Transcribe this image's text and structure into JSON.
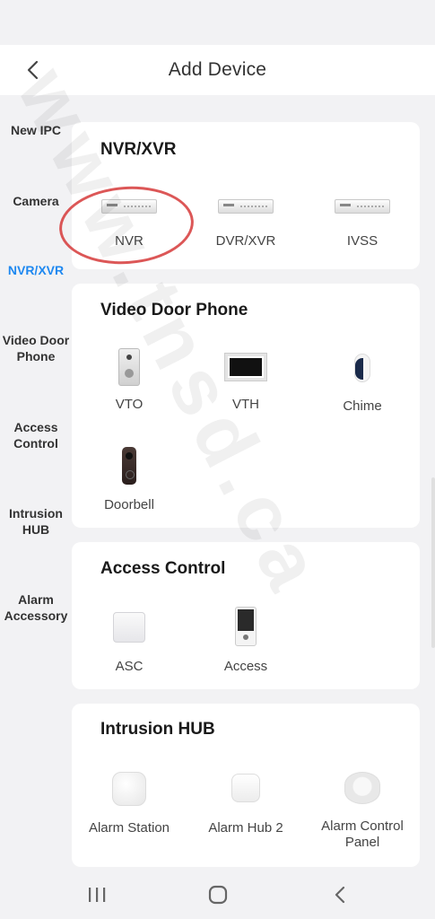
{
  "header": {
    "title": "Add Device",
    "back_icon": "chevron-left-icon"
  },
  "sidebar": {
    "active_color": "#1e88f0",
    "items": [
      {
        "label": "New IPC"
      },
      {
        "label": "Camera"
      },
      {
        "label": "NVR/XVR",
        "active": true
      },
      {
        "label": "Video Door Phone"
      },
      {
        "label": "Access Control"
      },
      {
        "label": "Intrusion HUB"
      },
      {
        "label": "Alarm Accessory"
      }
    ]
  },
  "sections": [
    {
      "title": "NVR/XVR",
      "devices": [
        {
          "label": "NVR",
          "icon": "nvr-device-icon"
        },
        {
          "label": "DVR/XVR",
          "icon": "dvr-device-icon"
        },
        {
          "label": "IVSS",
          "icon": "ivss-device-icon"
        }
      ]
    },
    {
      "title": "Video Door Phone",
      "devices": [
        {
          "label": "VTO",
          "icon": "vto-device-icon"
        },
        {
          "label": "VTH",
          "icon": "vth-device-icon"
        },
        {
          "label": "Chime",
          "icon": "chime-device-icon"
        },
        {
          "label": "Doorbell",
          "icon": "doorbell-device-icon"
        }
      ]
    },
    {
      "title": "Access Control",
      "devices": [
        {
          "label": "ASC",
          "icon": "asc-device-icon"
        },
        {
          "label": "Access",
          "icon": "access-device-icon"
        }
      ]
    },
    {
      "title": "Intrusion HUB",
      "devices": [
        {
          "label": "Alarm Station",
          "icon": "alarm-station-icon"
        },
        {
          "label": "Alarm Hub 2",
          "icon": "alarm-hub-icon"
        },
        {
          "label": "Alarm Control Panel",
          "icon": "alarm-panel-icon"
        }
      ]
    }
  ],
  "watermark": "www.tnsd.ca",
  "nav": {
    "recent_icon": "recent-apps-icon",
    "home_icon": "home-icon",
    "back_icon": "back-icon"
  }
}
